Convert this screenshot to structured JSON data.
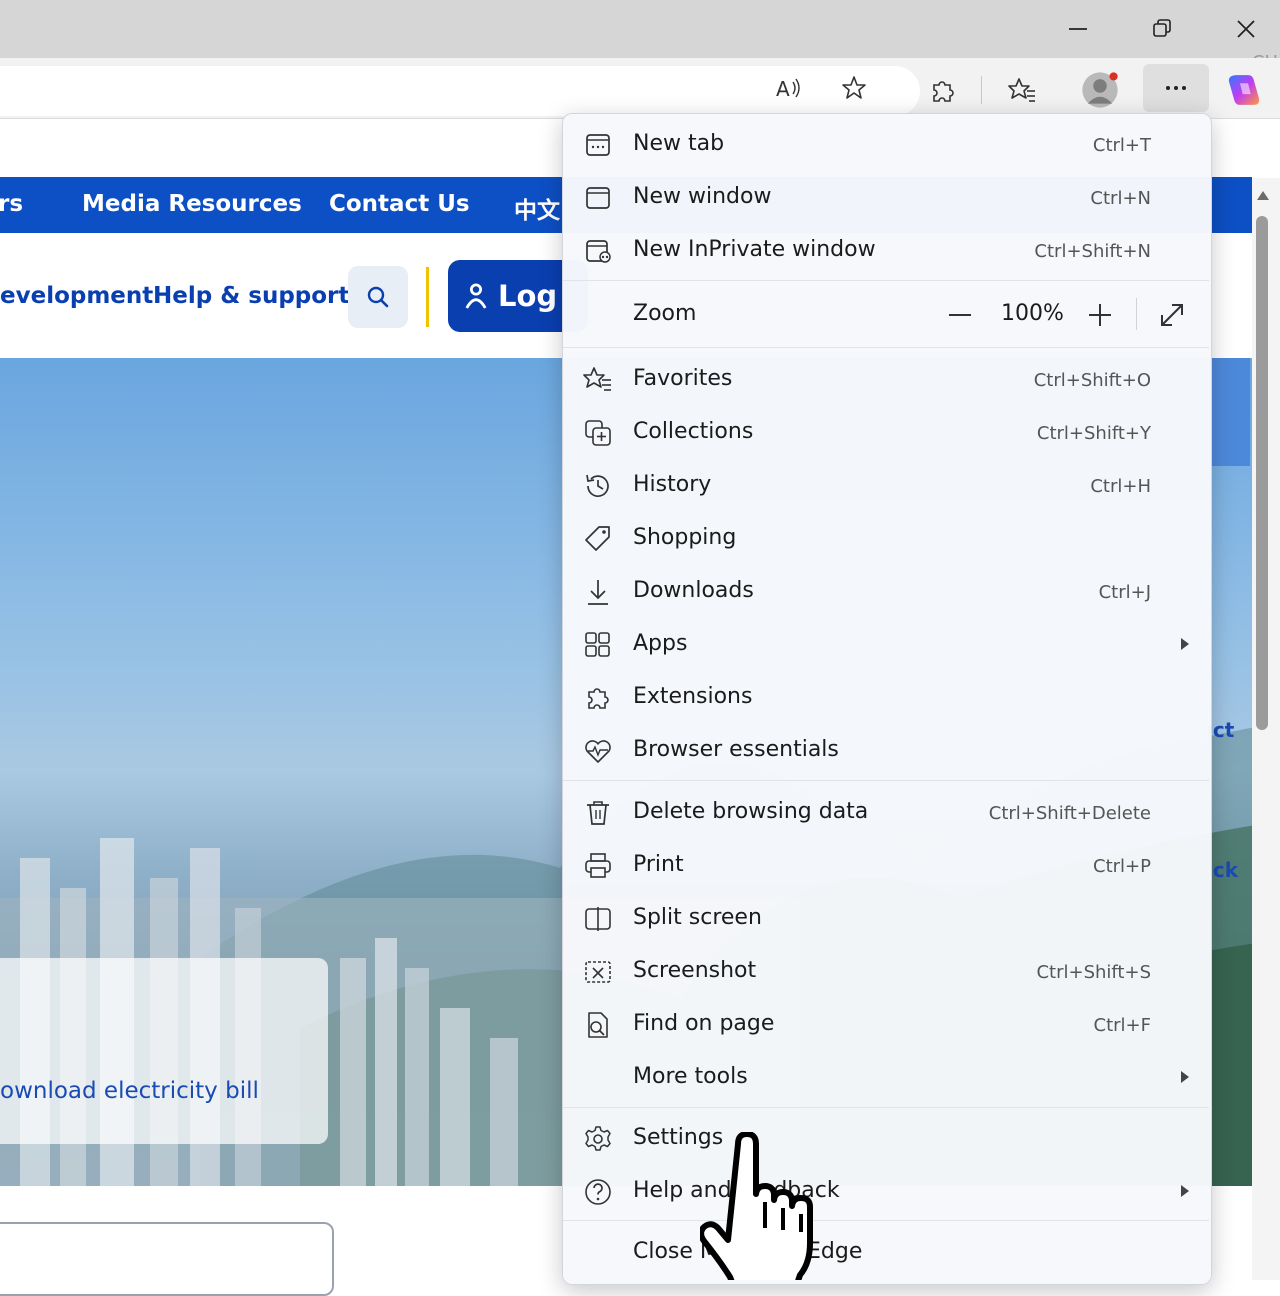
{
  "window": {
    "minimize_icon": "minimize-icon",
    "restore_icon": "restore-icon",
    "close_icon": "close-icon",
    "corner_text": "CH"
  },
  "toolbar": {
    "icons": [
      "read-aloud-icon",
      "favorite-star-icon",
      "extensions-icon",
      "favorites-icon",
      "profile-avatar",
      "more-icon",
      "copilot-icon"
    ]
  },
  "site": {
    "nav": {
      "items": [
        "rs",
        "Media Resources",
        "Contact Us",
        "中文"
      ]
    },
    "subnav": {
      "items": [
        "evelopment",
        "Help & support"
      ],
      "login_label": "Log"
    },
    "card_link": "ownload electricity bill",
    "side_text_1": "ıct",
    "side_text_2": "ıck"
  },
  "menu": {
    "items": [
      {
        "label": "New tab",
        "shortcut": "Ctrl+T"
      },
      {
        "label": "New window",
        "shortcut": "Ctrl+N"
      },
      {
        "label": "New InPrivate window",
        "shortcut": "Ctrl+Shift+N"
      },
      {
        "label": "Zoom",
        "value": "100%"
      },
      {
        "label": "Favorites",
        "shortcut": "Ctrl+Shift+O"
      },
      {
        "label": "Collections",
        "shortcut": "Ctrl+Shift+Y"
      },
      {
        "label": "History",
        "shortcut": "Ctrl+H"
      },
      {
        "label": "Shopping",
        "shortcut": ""
      },
      {
        "label": "Downloads",
        "shortcut": "Ctrl+J"
      },
      {
        "label": "Apps",
        "shortcut": ""
      },
      {
        "label": "Extensions",
        "shortcut": ""
      },
      {
        "label": "Browser essentials",
        "shortcut": ""
      },
      {
        "label": "Delete browsing data",
        "shortcut": "Ctrl+Shift+Delete"
      },
      {
        "label": "Print",
        "shortcut": "Ctrl+P"
      },
      {
        "label": "Split screen",
        "shortcut": ""
      },
      {
        "label": "Screenshot",
        "shortcut": "Ctrl+Shift+S"
      },
      {
        "label": "Find on page",
        "shortcut": "Ctrl+F"
      },
      {
        "label": "More tools",
        "shortcut": ""
      },
      {
        "label": "Settings",
        "shortcut": ""
      },
      {
        "label": "Help and feedback",
        "shortcut": ""
      },
      {
        "label": "Close Microsoft Edge",
        "shortcut": ""
      }
    ]
  },
  "colors": {
    "site_blue": "#0d4fc4",
    "link_blue": "#0a3fb0",
    "accent_yellow": "#f2c300"
  }
}
